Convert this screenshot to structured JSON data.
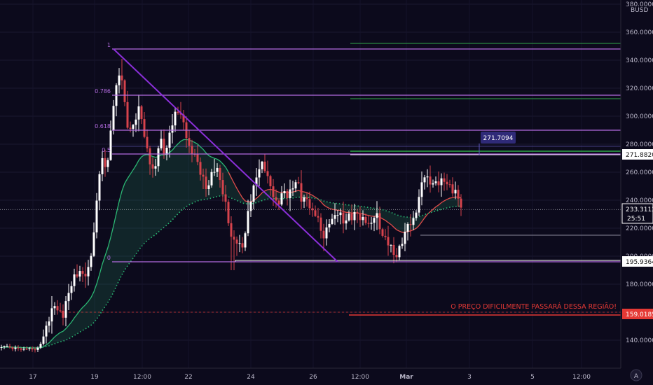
{
  "chart_data": {
    "type": "candlestick",
    "symbol": "BUSD",
    "x_ticks": [
      "17",
      "19",
      "12:00",
      "22",
      "24",
      "26",
      "12:00",
      "Mar",
      "3",
      "5",
      "12:00"
    ],
    "y_ticks": [
      "140.0000",
      "160.0000",
      "180.0000",
      "200.0000",
      "220.0000",
      "240.0000",
      "260.0000",
      "280.0000",
      "300.0000",
      "320.0000",
      "340.0000",
      "360.0000",
      "380.0000"
    ],
    "ylim": [
      125,
      385
    ],
    "last_price": "233.3112",
    "countdown": "25:51",
    "price_tags": [
      {
        "value": 271.882,
        "label": "271.8820"
      },
      {
        "value": 195.9364,
        "label": "195.9364"
      },
      {
        "value": 159.0185,
        "label": "159.0185"
      }
    ],
    "callout": {
      "value": 271.7094,
      "label": "271.7094"
    },
    "fib_levels": [
      {
        "ratio": "1",
        "value": 348
      },
      {
        "ratio": "0.786",
        "value": 315
      },
      {
        "ratio": "0.618",
        "value": 290
      },
      {
        "ratio": "0.5",
        "value": 273
      },
      {
        "ratio": "0",
        "value": 196
      }
    ],
    "horizontal_levels": [
      352,
      312.5,
      275,
      272.5,
      215,
      158
    ],
    "annotation": "O PREÇO DIFICILMENTE PASSARÁ DESSA REGIÃO!",
    "colors": {
      "background": "#0c0a1c",
      "up": "#ffffff",
      "down": "#d6434c",
      "fib": "#b36be0",
      "trendline": "#8b2fd9",
      "green_level": "#2fa84a",
      "red_level": "#e53935",
      "ma_short": "#e04a4a",
      "ma_long": "#2bb673"
    }
  }
}
